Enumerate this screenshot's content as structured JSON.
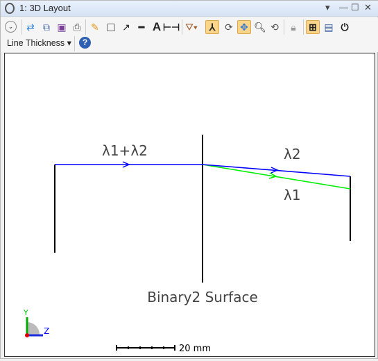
{
  "window": {
    "title": "1: 3D Layout",
    "menu_glyph": "▾",
    "min_glyph": "—",
    "max_glyph": "☐",
    "close_glyph": "✕"
  },
  "toolbar": {
    "line_thickness_label": "Line Thickness",
    "help_glyph": "?",
    "icons": [
      "expand-icon",
      "refresh-icon",
      "copy-icon",
      "save-icon",
      "print-icon",
      "pencil-icon",
      "rectangle-icon",
      "arrow-icon",
      "line-icon",
      "text-icon",
      "dimension-icon",
      "rotate-3d-icon",
      "axes-icon",
      "rotate-icon",
      "pan-icon",
      "zoom-icon",
      "reset-icon",
      "lock-icon",
      "fit-icon",
      "window-icon",
      "power-icon"
    ]
  },
  "plot": {
    "label_combined": "λ1+λ2",
    "label_l2": "λ2",
    "label_l1": "λ1",
    "surface_label": "Binary2 Surface",
    "scale_label": "20 mm",
    "axis_y": "Y",
    "axis_z": "Z",
    "colors": {
      "lambda2": "#0000ff",
      "lambda1": "#00ee00",
      "surface": "#000000"
    }
  }
}
